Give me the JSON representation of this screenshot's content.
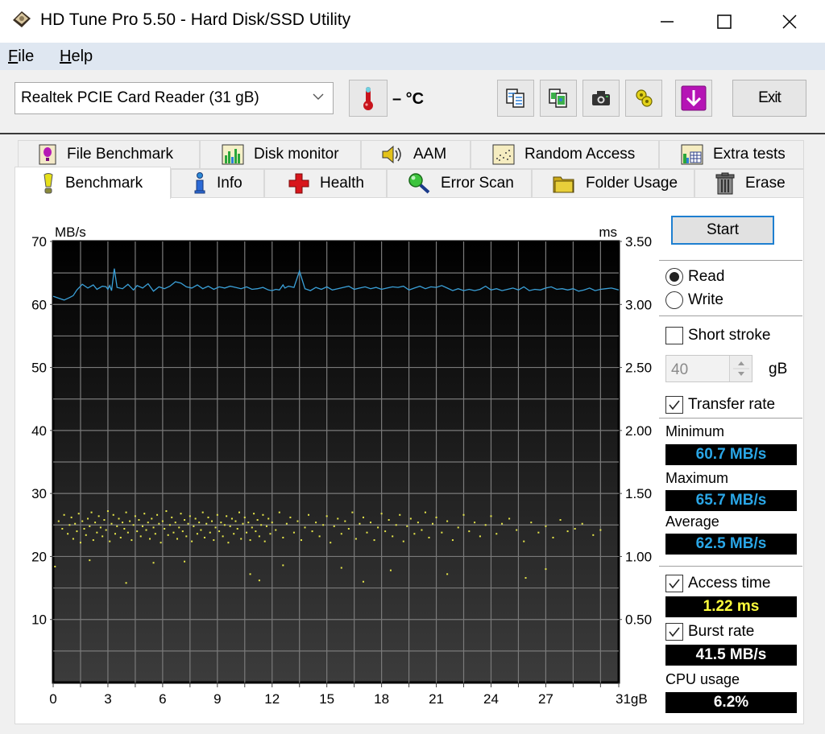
{
  "window": {
    "title": "HD Tune Pro 5.50 - Hard Disk/SSD Utility",
    "controls": [
      "minimize",
      "maximize",
      "close"
    ]
  },
  "menu": {
    "items": [
      {
        "label": "File",
        "accel": "F",
        "rest": "ile"
      },
      {
        "label": "Help",
        "accel": "H",
        "rest": "elp"
      }
    ]
  },
  "toolbar": {
    "drive": "Realtek PCIE Card Reader (31 gB)",
    "temperature": "– °C",
    "buttons": [
      "copy-info",
      "copy-screenshot",
      "save-screenshot",
      "options",
      "download"
    ],
    "exit_label": "Exit"
  },
  "tabs": {
    "row1": [
      {
        "label": "File Benchmark",
        "icon": "file-benchmark-icon"
      },
      {
        "label": "Disk monitor",
        "icon": "disk-monitor-icon"
      },
      {
        "label": "AAM",
        "icon": "speaker-icon"
      },
      {
        "label": "Random Access",
        "icon": "random-access-icon"
      },
      {
        "label": "Extra tests",
        "icon": "extra-tests-icon"
      }
    ],
    "row2": [
      {
        "label": "Benchmark",
        "icon": "benchmark-icon",
        "active": true
      },
      {
        "label": "Info",
        "icon": "info-icon"
      },
      {
        "label": "Health",
        "icon": "health-icon"
      },
      {
        "label": "Error Scan",
        "icon": "magnifier-icon"
      },
      {
        "label": "Folder Usage",
        "icon": "folder-icon"
      },
      {
        "label": "Erase",
        "icon": "trash-icon"
      }
    ]
  },
  "side": {
    "start_label": "Start",
    "mode": {
      "read": "Read",
      "write": "Write",
      "selected": "read"
    },
    "short_stroke": {
      "label": "Short stroke",
      "checked": false,
      "value": "40",
      "unit": "gB"
    },
    "transfer_rate": {
      "label": "Transfer rate",
      "checked": true
    },
    "minimum": {
      "label": "Minimum",
      "value": "60.7 MB/s"
    },
    "maximum": {
      "label": "Maximum",
      "value": "65.7 MB/s"
    },
    "average": {
      "label": "Average",
      "value": "62.5 MB/s"
    },
    "access_time": {
      "label": "Access time",
      "checked": true,
      "value": "1.22 ms"
    },
    "burst_rate": {
      "label": "Burst rate",
      "checked": true,
      "value": "41.5 MB/s"
    },
    "cpu_usage": {
      "label": "CPU usage",
      "value": "6.2%"
    }
  },
  "colors": {
    "transfer_line": "#3aa0d8",
    "access_dots": "#e8e84a",
    "stat_blue": "#2aa6e6",
    "stat_yellow": "#ffff3c",
    "stat_white": "#ffffff",
    "start_border": "#1e7fd0"
  },
  "chart_data": {
    "type": "line",
    "title": "",
    "xlabel": "gB",
    "ylabel_left": "MB/s",
    "ylabel_right": "ms",
    "xlim": [
      0,
      31
    ],
    "ylim_left": [
      0,
      70
    ],
    "ylim_right": [
      0,
      3.5
    ],
    "x_ticks": [
      "0",
      "3",
      "6",
      "9",
      "12",
      "15",
      "18",
      "21",
      "24",
      "27",
      "31gB"
    ],
    "x_tick_values": [
      0,
      3,
      6,
      9,
      12,
      15,
      18,
      21,
      24,
      27,
      31
    ],
    "y_left_ticks": [
      "10",
      "20",
      "30",
      "40",
      "50",
      "60",
      "70"
    ],
    "y_left_tick_values": [
      10,
      20,
      30,
      40,
      50,
      60,
      70
    ],
    "y_right_ticks": [
      "0.50",
      "1.00",
      "1.50",
      "2.00",
      "2.50",
      "3.00",
      "3.50"
    ],
    "y_right_tick_values": [
      0.5,
      1.0,
      1.5,
      2.0,
      2.5,
      3.0,
      3.5
    ],
    "grid": true,
    "series": [
      {
        "name": "Transfer rate (MB/s)",
        "axis": "left",
        "x": [
          0,
          0.3,
          0.6,
          0.9,
          1.1,
          1.3,
          1.6,
          1.9,
          2.2,
          2.4,
          2.7,
          2.9,
          3.0,
          3.1,
          3.2,
          3.35,
          3.5,
          3.8,
          4.1,
          4.4,
          4.6,
          4.9,
          5.2,
          5.5,
          5.8,
          6.1,
          6.4,
          6.7,
          7.0,
          7.3,
          7.6,
          7.9,
          8.2,
          8.5,
          8.8,
          9.1,
          9.4,
          9.7,
          10.0,
          10.3,
          10.6,
          10.9,
          11.2,
          11.5,
          11.8,
          12.0,
          12.2,
          12.4,
          12.6,
          12.7,
          12.9,
          13.2,
          13.5,
          13.8,
          14.1,
          14.4,
          14.7,
          15.0,
          15.3,
          15.6,
          15.9,
          16.2,
          16.5,
          16.8,
          17.1,
          17.4,
          17.7,
          18.0,
          18.3,
          18.6,
          18.9,
          19.2,
          19.5,
          19.8,
          20.1,
          20.4,
          20.7,
          21.0,
          21.3,
          21.6,
          21.9,
          22.2,
          22.5,
          22.8,
          23.1,
          23.4,
          23.7,
          24.0,
          24.3,
          24.6,
          24.9,
          25.2,
          25.5,
          25.8,
          26.1,
          26.4,
          26.7,
          27.0,
          27.3,
          27.6,
          27.9,
          28.2,
          28.5,
          28.8,
          29.1,
          29.4,
          29.7,
          30.0,
          30.3,
          30.6,
          31.0
        ],
        "values": [
          61.3,
          61.0,
          60.7,
          61.1,
          61.4,
          62.3,
          63.2,
          62.6,
          63.1,
          62.4,
          62.9,
          62.8,
          62.4,
          63.0,
          62.2,
          65.7,
          62.7,
          62.5,
          63.2,
          62.3,
          63.0,
          62.6,
          63.3,
          62.1,
          62.8,
          62.5,
          62.9,
          63.6,
          63.4,
          62.8,
          62.6,
          63.1,
          62.5,
          62.9,
          62.4,
          62.8,
          62.6,
          62.9,
          62.7,
          62.5,
          62.8,
          62.4,
          62.5,
          62.7,
          62.3,
          62.2,
          62.4,
          62.3,
          63.1,
          62.6,
          62.9,
          62.7,
          65.3,
          62.5,
          62.2,
          62.7,
          62.4,
          62.8,
          62.3,
          62.5,
          62.7,
          62.9,
          62.4,
          62.6,
          62.8,
          62.5,
          62.7,
          62.4,
          62.6,
          62.8,
          62.7,
          62.9,
          62.3,
          62.6,
          62.9,
          62.5,
          62.8,
          62.7,
          63.0,
          62.6,
          62.2,
          62.5,
          62.2,
          62.4,
          62.2,
          62.4,
          62.9,
          62.3,
          62.5,
          62.2,
          62.4,
          62.6,
          62.3,
          62.8,
          62.2,
          62.4,
          62.3,
          62.6,
          62.8,
          62.4,
          62.5,
          62.3,
          62.5,
          62.1,
          62.3,
          62.6,
          62.2,
          62.4,
          62.5,
          62.6,
          62.3
        ]
      },
      {
        "name": "Access time (ms)",
        "axis": "right",
        "kind": "scatter",
        "density_note": "dense cluster 1.05–1.40 ms across full range, sparser beyond 22 gB, outliers 0.75–0.95 ms",
        "points": [
          [
            0.3,
            1.28
          ],
          [
            0.5,
            1.22
          ],
          [
            0.6,
            1.33
          ],
          [
            0.8,
            1.18
          ],
          [
            0.9,
            1.25
          ],
          [
            1.0,
            1.31
          ],
          [
            1.1,
            1.14
          ],
          [
            1.2,
            1.26
          ],
          [
            1.3,
            1.2
          ],
          [
            1.4,
            1.34
          ],
          [
            1.5,
            1.11
          ],
          [
            1.6,
            1.28
          ],
          [
            1.7,
            1.22
          ],
          [
            1.8,
            1.17
          ],
          [
            1.9,
            1.3
          ],
          [
            2.0,
            1.24
          ],
          [
            2.1,
            1.35
          ],
          [
            2.2,
            1.13
          ],
          [
            2.3,
            1.27
          ],
          [
            2.4,
            1.19
          ],
          [
            2.5,
            1.32
          ],
          [
            2.6,
            1.23
          ],
          [
            2.7,
            1.16
          ],
          [
            2.8,
            1.29
          ],
          [
            2.9,
            1.21
          ],
          [
            3.0,
            1.36
          ],
          [
            3.1,
            1.12
          ],
          [
            3.2,
            1.26
          ],
          [
            3.3,
            1.33
          ],
          [
            3.4,
            1.18
          ],
          [
            3.5,
            1.24
          ],
          [
            3.6,
            1.3
          ],
          [
            3.7,
            1.15
          ],
          [
            3.8,
            1.27
          ],
          [
            3.9,
            1.22
          ],
          [
            4.0,
            1.35
          ],
          [
            4.1,
            1.19
          ],
          [
            4.2,
            1.28
          ],
          [
            4.3,
            1.13
          ],
          [
            4.4,
            1.25
          ],
          [
            4.5,
            1.32
          ],
          [
            4.6,
            1.2
          ],
          [
            4.7,
            1.29
          ],
          [
            4.8,
            1.16
          ],
          [
            4.9,
            1.24
          ],
          [
            5.0,
            1.34
          ],
          [
            5.1,
            1.21
          ],
          [
            5.2,
            1.27
          ],
          [
            5.3,
            1.14
          ],
          [
            5.4,
            1.3
          ],
          [
            5.5,
            1.23
          ],
          [
            5.6,
            1.18
          ],
          [
            5.7,
            1.33
          ],
          [
            5.8,
            1.26
          ],
          [
            5.9,
            1.11
          ],
          [
            6.0,
            1.28
          ],
          [
            6.1,
            1.22
          ],
          [
            6.2,
            1.36
          ],
          [
            6.3,
            1.17
          ],
          [
            6.4,
            1.25
          ],
          [
            6.5,
            1.31
          ],
          [
            6.6,
            1.19
          ],
          [
            6.7,
            1.27
          ],
          [
            6.8,
            1.14
          ],
          [
            6.9,
            1.23
          ],
          [
            7.0,
            1.34
          ],
          [
            7.1,
            1.2
          ],
          [
            7.2,
            1.29
          ],
          [
            7.3,
            1.16
          ],
          [
            7.4,
            1.26
          ],
          [
            7.5,
            1.32
          ],
          [
            7.6,
            1.12
          ],
          [
            7.7,
            1.24
          ],
          [
            7.8,
            1.3
          ],
          [
            7.9,
            1.18
          ],
          [
            8.0,
            1.27
          ],
          [
            8.1,
            1.21
          ],
          [
            8.2,
            1.35
          ],
          [
            8.3,
            1.15
          ],
          [
            8.4,
            1.26
          ],
          [
            8.5,
            1.31
          ],
          [
            8.6,
            1.19
          ],
          [
            8.7,
            1.28
          ],
          [
            8.8,
            1.13
          ],
          [
            8.9,
            1.23
          ],
          [
            9.0,
            1.33
          ],
          [
            9.1,
            1.2
          ],
          [
            9.2,
            1.27
          ],
          [
            9.3,
            1.16
          ],
          [
            9.4,
            1.25
          ],
          [
            9.5,
            1.32
          ],
          [
            9.6,
            1.11
          ],
          [
            9.7,
            1.24
          ],
          [
            9.8,
            1.3
          ],
          [
            9.9,
            1.18
          ],
          [
            10.0,
            1.28
          ],
          [
            10.1,
            1.22
          ],
          [
            10.2,
            1.35
          ],
          [
            10.3,
            1.14
          ],
          [
            10.4,
            1.26
          ],
          [
            10.5,
            1.31
          ],
          [
            10.6,
            1.19
          ],
          [
            10.7,
            1.27
          ],
          [
            10.8,
            1.13
          ],
          [
            10.9,
            1.23
          ],
          [
            11.0,
            1.34
          ],
          [
            11.1,
            1.2
          ],
          [
            11.2,
            1.29
          ],
          [
            11.3,
            1.16
          ],
          [
            11.4,
            1.25
          ],
          [
            11.5,
            1.33
          ],
          [
            11.6,
            1.12
          ],
          [
            11.7,
            1.24
          ],
          [
            11.8,
            1.3
          ],
          [
            11.9,
            1.18
          ],
          [
            12.0,
            1.27
          ],
          [
            12.2,
            1.21
          ],
          [
            12.4,
            1.35
          ],
          [
            12.6,
            1.15
          ],
          [
            12.8,
            1.26
          ],
          [
            13.0,
            1.31
          ],
          [
            13.2,
            1.19
          ],
          [
            13.4,
            1.28
          ],
          [
            13.6,
            1.13
          ],
          [
            13.8,
            1.23
          ],
          [
            14.0,
            1.33
          ],
          [
            14.2,
            1.2
          ],
          [
            14.4,
            1.27
          ],
          [
            14.6,
            1.16
          ],
          [
            14.8,
            1.25
          ],
          [
            15.0,
            1.32
          ],
          [
            15.2,
            1.11
          ],
          [
            15.4,
            1.24
          ],
          [
            15.6,
            1.3
          ],
          [
            15.8,
            1.18
          ],
          [
            16.0,
            1.28
          ],
          [
            16.2,
            1.22
          ],
          [
            16.4,
            1.35
          ],
          [
            16.6,
            1.14
          ],
          [
            16.8,
            1.26
          ],
          [
            17.0,
            1.31
          ],
          [
            17.2,
            1.19
          ],
          [
            17.4,
            1.27
          ],
          [
            17.6,
            1.13
          ],
          [
            17.8,
            1.23
          ],
          [
            18.0,
            1.34
          ],
          [
            18.2,
            1.2
          ],
          [
            18.4,
            1.29
          ],
          [
            18.6,
            1.16
          ],
          [
            18.8,
            1.25
          ],
          [
            19.0,
            1.33
          ],
          [
            19.2,
            1.12
          ],
          [
            19.4,
            1.24
          ],
          [
            19.6,
            1.3
          ],
          [
            19.8,
            1.18
          ],
          [
            20.0,
            1.27
          ],
          [
            20.2,
            1.21
          ],
          [
            20.4,
            1.35
          ],
          [
            20.6,
            1.15
          ],
          [
            20.8,
            1.26
          ],
          [
            21.0,
            1.31
          ],
          [
            21.3,
            1.19
          ],
          [
            21.6,
            1.28
          ],
          [
            21.9,
            1.13
          ],
          [
            22.2,
            1.23
          ],
          [
            22.5,
            1.33
          ],
          [
            22.8,
            1.2
          ],
          [
            23.1,
            1.27
          ],
          [
            23.4,
            1.16
          ],
          [
            23.7,
            1.25
          ],
          [
            24.0,
            1.32
          ],
          [
            24.3,
            1.18
          ],
          [
            24.6,
            1.26
          ],
          [
            25.0,
            1.3
          ],
          [
            25.4,
            1.21
          ],
          [
            25.8,
            1.12
          ],
          [
            26.2,
            1.27
          ],
          [
            26.6,
            1.19
          ],
          [
            27.0,
            1.24
          ],
          [
            27.4,
            1.15
          ],
          [
            27.8,
            1.29
          ],
          [
            28.2,
            1.2
          ],
          [
            28.6,
            1.22
          ],
          [
            29.0,
            1.26
          ],
          [
            29.6,
            1.17
          ],
          [
            30.0,
            1.21
          ],
          [
            0.1,
            0.92
          ],
          [
            2.0,
            0.97
          ],
          [
            4.0,
            0.79
          ],
          [
            5.5,
            0.95
          ],
          [
            7.2,
            0.96
          ],
          [
            10.8,
            0.86
          ],
          [
            11.3,
            0.81
          ],
          [
            12.6,
            0.93
          ],
          [
            15.8,
            0.91
          ],
          [
            17.0,
            0.8
          ],
          [
            18.5,
            0.89
          ],
          [
            21.6,
            0.86
          ],
          [
            25.9,
            0.83
          ],
          [
            27.0,
            0.9
          ]
        ]
      }
    ]
  }
}
